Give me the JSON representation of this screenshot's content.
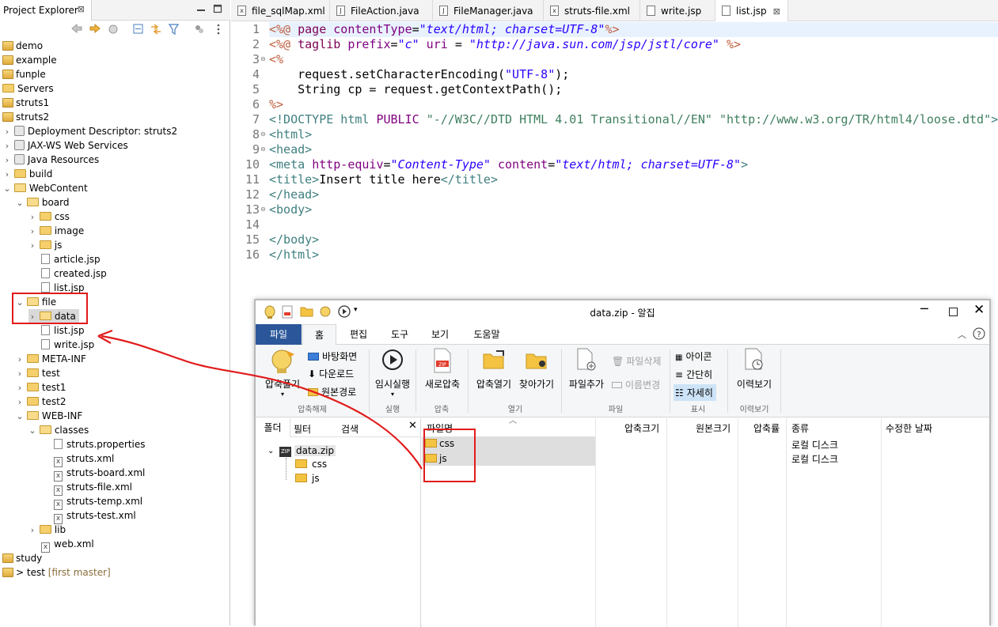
{
  "explorer": {
    "tab_label": "Project Explorer",
    "close_glyph": "⊠",
    "tree": [
      {
        "label": "demo",
        "icon": "project-icon"
      },
      {
        "label": "example",
        "icon": "project-icon"
      },
      {
        "label": "funple",
        "icon": "project-icon"
      },
      {
        "label": "Servers",
        "icon": "folder-icon"
      },
      {
        "label": "struts1",
        "icon": "project-icon"
      },
      {
        "label": "struts2",
        "icon": "project-icon"
      },
      {
        "label": "Deployment Descriptor: struts2",
        "icon": "descriptor-icon"
      },
      {
        "label": "JAX-WS Web Services",
        "icon": "webservice-icon"
      },
      {
        "label": "Java Resources",
        "icon": "java-resources-icon"
      },
      {
        "label": "build",
        "icon": "folder-icon"
      },
      {
        "label": "WebContent",
        "icon": "folder-icon"
      },
      {
        "label": "board",
        "icon": "folder-icon"
      },
      {
        "label": "css",
        "icon": "folder-icon"
      },
      {
        "label": "image",
        "icon": "folder-icon"
      },
      {
        "label": "js",
        "icon": "folder-icon"
      },
      {
        "label": "article.jsp",
        "icon": "jsp-file-icon"
      },
      {
        "label": "created.jsp",
        "icon": "jsp-file-icon"
      },
      {
        "label": "list.jsp",
        "icon": "jsp-file-icon"
      },
      {
        "label": "file",
        "icon": "folder-icon"
      },
      {
        "label": "data",
        "icon": "folder-icon"
      },
      {
        "label": "list.jsp",
        "icon": "jsp-file-icon"
      },
      {
        "label": "write.jsp",
        "icon": "jsp-file-icon"
      },
      {
        "label": "META-INF",
        "icon": "folder-icon"
      },
      {
        "label": "test",
        "icon": "folder-icon"
      },
      {
        "label": "test1",
        "icon": "folder-icon"
      },
      {
        "label": "test2",
        "icon": "folder-icon"
      },
      {
        "label": "WEB-INF",
        "icon": "folder-icon"
      },
      {
        "label": "classes",
        "icon": "folder-icon"
      },
      {
        "label": "struts.properties",
        "icon": "properties-file-icon"
      },
      {
        "label": "struts.xml",
        "icon": "xml-file-icon"
      },
      {
        "label": "struts-board.xml",
        "icon": "xml-file-icon"
      },
      {
        "label": "struts-file.xml",
        "icon": "xml-file-icon"
      },
      {
        "label": "struts-temp.xml",
        "icon": "xml-file-icon"
      },
      {
        "label": "struts-test.xml",
        "icon": "xml-file-icon"
      },
      {
        "label": "lib",
        "icon": "folder-icon"
      },
      {
        "label": "web.xml",
        "icon": "xml-file-icon"
      },
      {
        "label": "study",
        "icon": "project-icon"
      },
      {
        "label": "> test",
        "icon": "git-project-icon"
      }
    ],
    "git_branch": "[first master]"
  },
  "editor": {
    "tabs": [
      {
        "label": "file_sqlMap.xml",
        "icon": "xml-file-icon"
      },
      {
        "label": "FileAction.java",
        "icon": "java-file-icon"
      },
      {
        "label": "FileManager.java",
        "icon": "java-file-icon"
      },
      {
        "label": "struts-file.xml",
        "icon": "xml-file-icon"
      },
      {
        "label": "write.jsp",
        "icon": "jsp-file-icon"
      },
      {
        "label": "list.jsp",
        "icon": "jsp-file-icon",
        "active": true
      }
    ],
    "line_numbers": [
      "1",
      "2",
      "3",
      "4",
      "5",
      "6",
      "7",
      "8",
      "9",
      "10",
      "11",
      "12",
      "13",
      "14",
      "15",
      "16"
    ],
    "code": {
      "l1_open": "<%@ ",
      "l1_dir": "page ",
      "l1_attr": "contentType",
      "l1_eq": "=",
      "l1_val": "\"text/html; charset=UTF-8\"",
      "l1_close": "%>",
      "l2_open": "<%@ ",
      "l2_dir": "taglib ",
      "l2_attr1": "prefix",
      "l2_eq1": "=",
      "l2_val1": "\"c\"",
      "l2_attr2": " uri ",
      "l2_eq2": "= ",
      "l2_val2": "\"http://java.sun.com/jsp/jstl/core\"",
      "l2_close": " %>",
      "l3": "<%",
      "l4": "    request.setCharacterEncoding(",
      "l4_str": "\"UTF-8\"",
      "l4_end": ");",
      "l5": "    String cp = request.getContextPath();",
      "l6": "%>",
      "l7_open": "<!DOCTYPE html ",
      "l7_public": "PUBLIC ",
      "l7_s1": "\"-//W3C//DTD HTML 4.01 Transitional//EN\"",
      "l7_s2": " \"http://www.w3.org/TR/html4/loose.dtd\"",
      "l7_close": ">",
      "l8": "<html>",
      "l9": "<head>",
      "l10_open": "<meta ",
      "l10_attr1": "http-equiv",
      "l10_eq1": "=",
      "l10_val1": "\"Content-Type\"",
      "l10_attr2": " content",
      "l10_eq2": "=",
      "l10_val2": "\"text/html; charset=UTF-8\"",
      "l10_close": ">",
      "l11_open": "<title>",
      "l11_text": "Insert title here",
      "l11_close": "</title>",
      "l12": "</head>",
      "l13": "<body>",
      "l14": "",
      "l15": "</body>",
      "l16": "</html>"
    }
  },
  "bandizip": {
    "title": "data.zip - 알집",
    "tabs": [
      "파일",
      "홈",
      "편집",
      "도구",
      "보기",
      "도움말"
    ],
    "ribbon": {
      "extract": "압축풀기",
      "desktop": "바탕화면",
      "downloads": "다운로드",
      "original_path": "원본경로",
      "group_extract": "압축해제",
      "run_temp": "임시실행",
      "group_run": "실행",
      "new_archive": "새로압축",
      "group_compress": "압축",
      "open_archive": "압축열기",
      "find": "찾아가기",
      "group_open": "열기",
      "add_file": "파일추가",
      "delete_file": "파일삭제",
      "rename": "이름변경",
      "group_file": "파일",
      "view_icons": "아이콘",
      "view_simple": "간단히",
      "view_details": "자세히",
      "group_view": "표시",
      "history": "이력보기",
      "group_history": "이력보기"
    },
    "left_tabs": [
      "폴더",
      "필터",
      "검색"
    ],
    "left_tree": {
      "root": "data.zip",
      "children": [
        "css",
        "js"
      ]
    },
    "columns": [
      "파일명",
      "압축크기",
      "원본크기",
      "압축률",
      "종류",
      "수정한 날짜"
    ],
    "rows": [
      {
        "name": "css",
        "kind": "로컬 디스크"
      },
      {
        "name": "js",
        "kind": "로컬 디스크"
      }
    ]
  },
  "colors": {
    "annotation_red": "#e21b1b",
    "ribbon_file_tab": "#2b579a",
    "line_highlight": "#e8f2fe"
  }
}
